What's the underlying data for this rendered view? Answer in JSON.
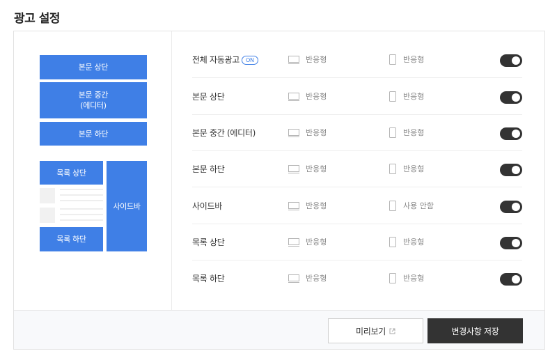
{
  "page": {
    "title": "광고 설정"
  },
  "preview": {
    "body_top": "본문 상단",
    "body_middle_line1": "본문 중간",
    "body_middle_line2": "(에디터)",
    "body_bottom": "본문 하단",
    "list_top": "목록 상단",
    "list_bottom": "목록 하단",
    "sidebar": "사이드바",
    "block_color": "#3f7fe6"
  },
  "settings": {
    "on_badge": "ON",
    "rows": [
      {
        "label": "전체 자동광고",
        "pc": "반응형",
        "mobile": "반응형",
        "enabled": true
      },
      {
        "label": "본문 상단",
        "pc": "반응형",
        "mobile": "반응형",
        "enabled": true
      },
      {
        "label": "본문 중간 (에디터)",
        "pc": "반응형",
        "mobile": "반응형",
        "enabled": true
      },
      {
        "label": "본문 하단",
        "pc": "반응형",
        "mobile": "반응형",
        "enabled": true
      },
      {
        "label": "사이드바",
        "pc": "반응형",
        "mobile": "사용 안함",
        "enabled": true
      },
      {
        "label": "목록 상단",
        "pc": "반응형",
        "mobile": "반응형",
        "enabled": true
      },
      {
        "label": "목록 하단",
        "pc": "반응형",
        "mobile": "반응형",
        "enabled": true
      }
    ]
  },
  "footer": {
    "preview_label": "미리보기",
    "save_label": "변경사항 저장"
  },
  "icons": {
    "pc": "monitor-icon",
    "mobile": "smartphone-icon",
    "external": "external-link-icon"
  },
  "colors": {
    "accent": "#3f7fe6",
    "toggle_on": "#333333",
    "save_button": "#333333"
  }
}
